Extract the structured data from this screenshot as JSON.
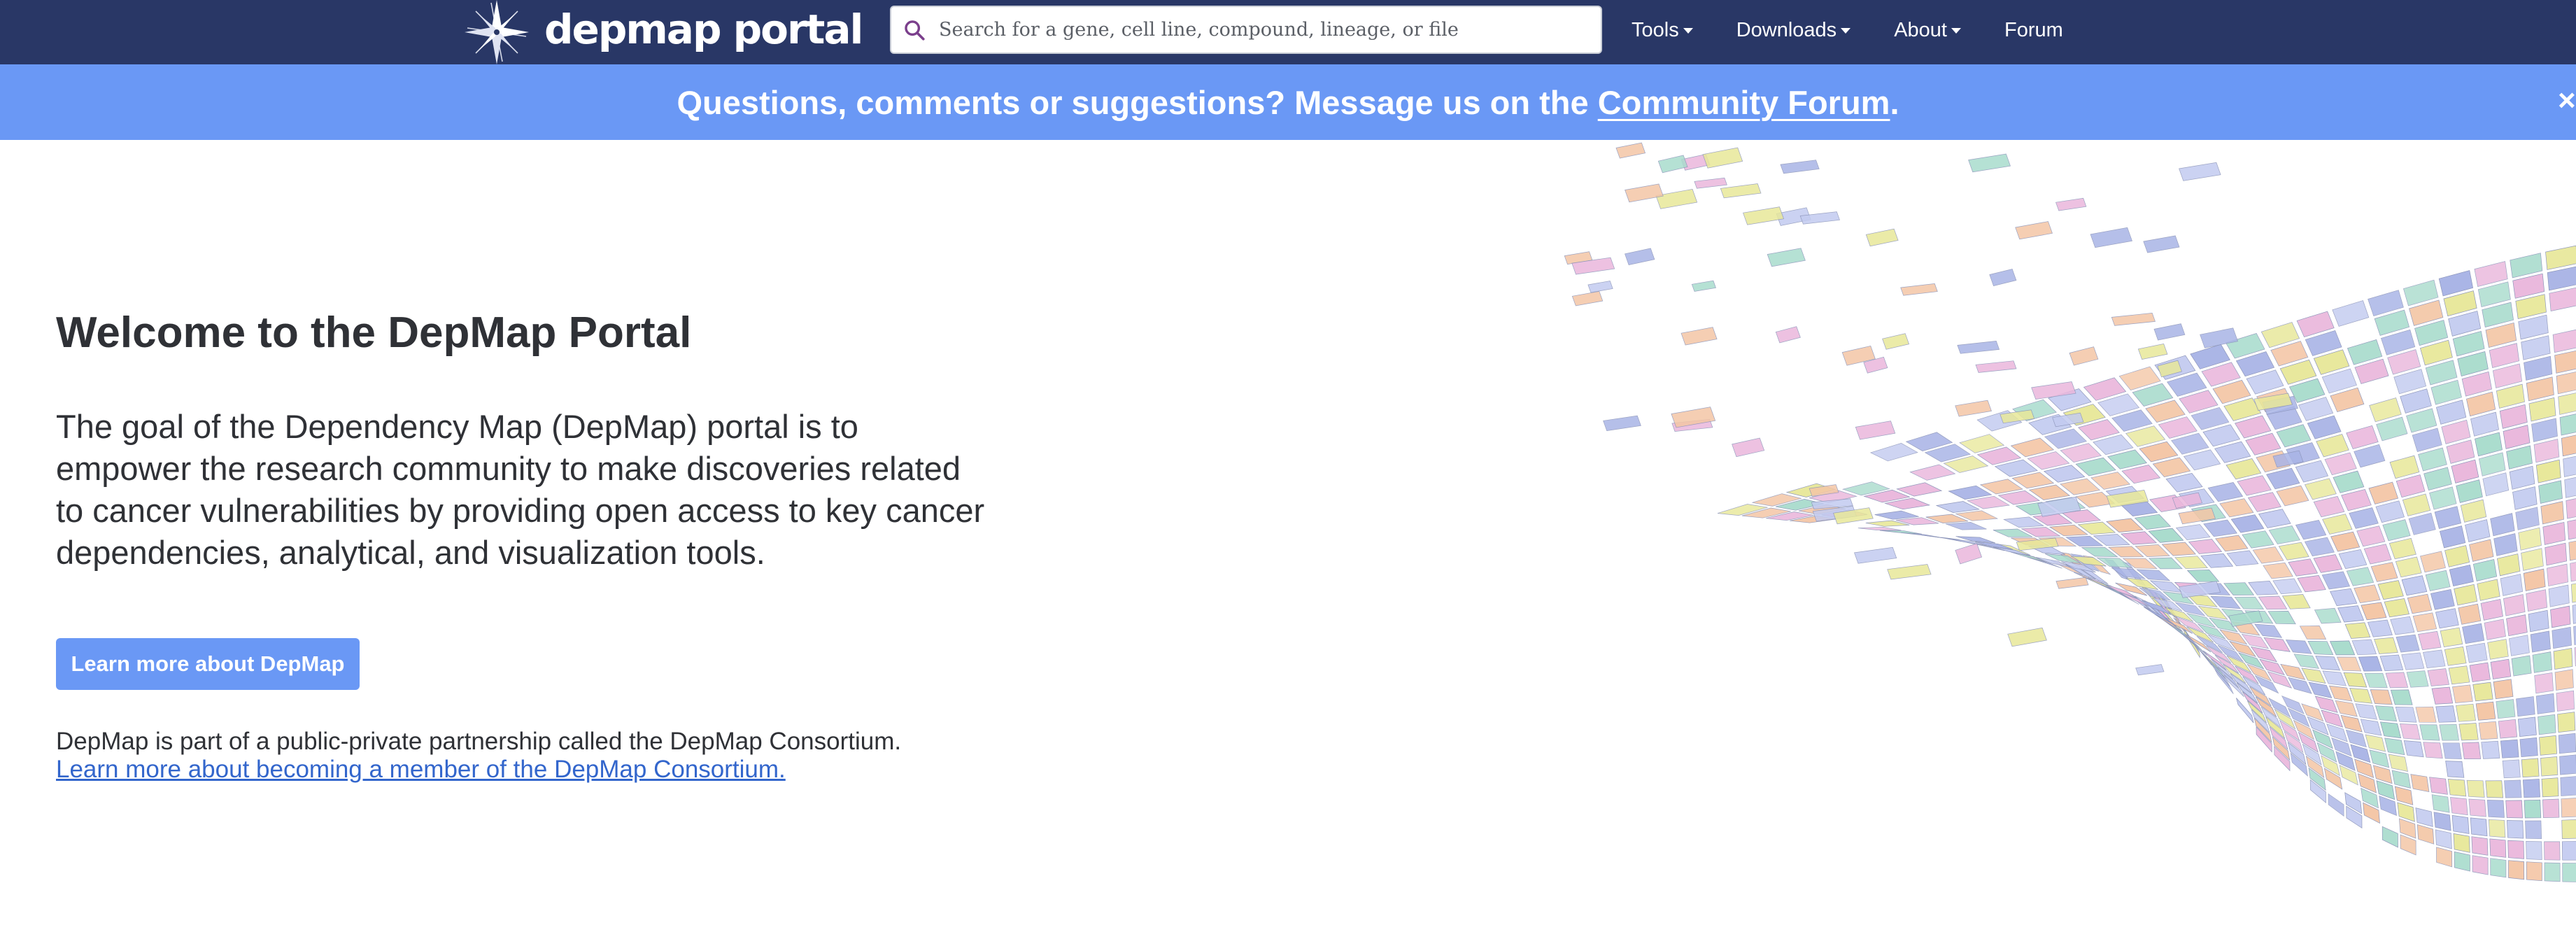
{
  "header": {
    "brand": "depmap portal",
    "search": {
      "placeholder": "Search for a gene, cell line, compound, lineage, or file",
      "value": ""
    },
    "nav": [
      {
        "label": "Tools",
        "dropdown": true
      },
      {
        "label": "Downloads",
        "dropdown": true
      },
      {
        "label": "About",
        "dropdown": true
      },
      {
        "label": "Forum",
        "dropdown": false
      }
    ]
  },
  "banner": {
    "text": "Questions, comments or suggestions? Message us on the",
    "link_text": "Community Forum",
    "trailing": ".",
    "close": "×"
  },
  "main": {
    "title": "Welcome to the DepMap Portal",
    "description": "The goal of the Dependency Map (DepMap) portal is to empower the research community to make discoveries related to cancer vulnerabilities by providing open access to key cancer dependencies, analytical, and visualization tools.",
    "button_label": "Learn more about DepMap",
    "consortium_text": "DepMap is part of a public-private partnership called the DepMap Consortium.",
    "consortium_link": "Learn more about becoming a member of the DepMap Consortium."
  },
  "theme": {
    "navbar_bg": "#293766",
    "banner_bg": "#6a98f5",
    "link": "#3366cc",
    "graphic_palette": [
      "#a9b4e6",
      "#e8e89a",
      "#a9dccd",
      "#f4c6a6",
      "#eab7dc",
      "#c3cbf0"
    ]
  },
  "icons": {
    "logo": "compass-star-icon",
    "search": "search-icon",
    "caret": "caret-down-icon",
    "close": "close-icon"
  }
}
